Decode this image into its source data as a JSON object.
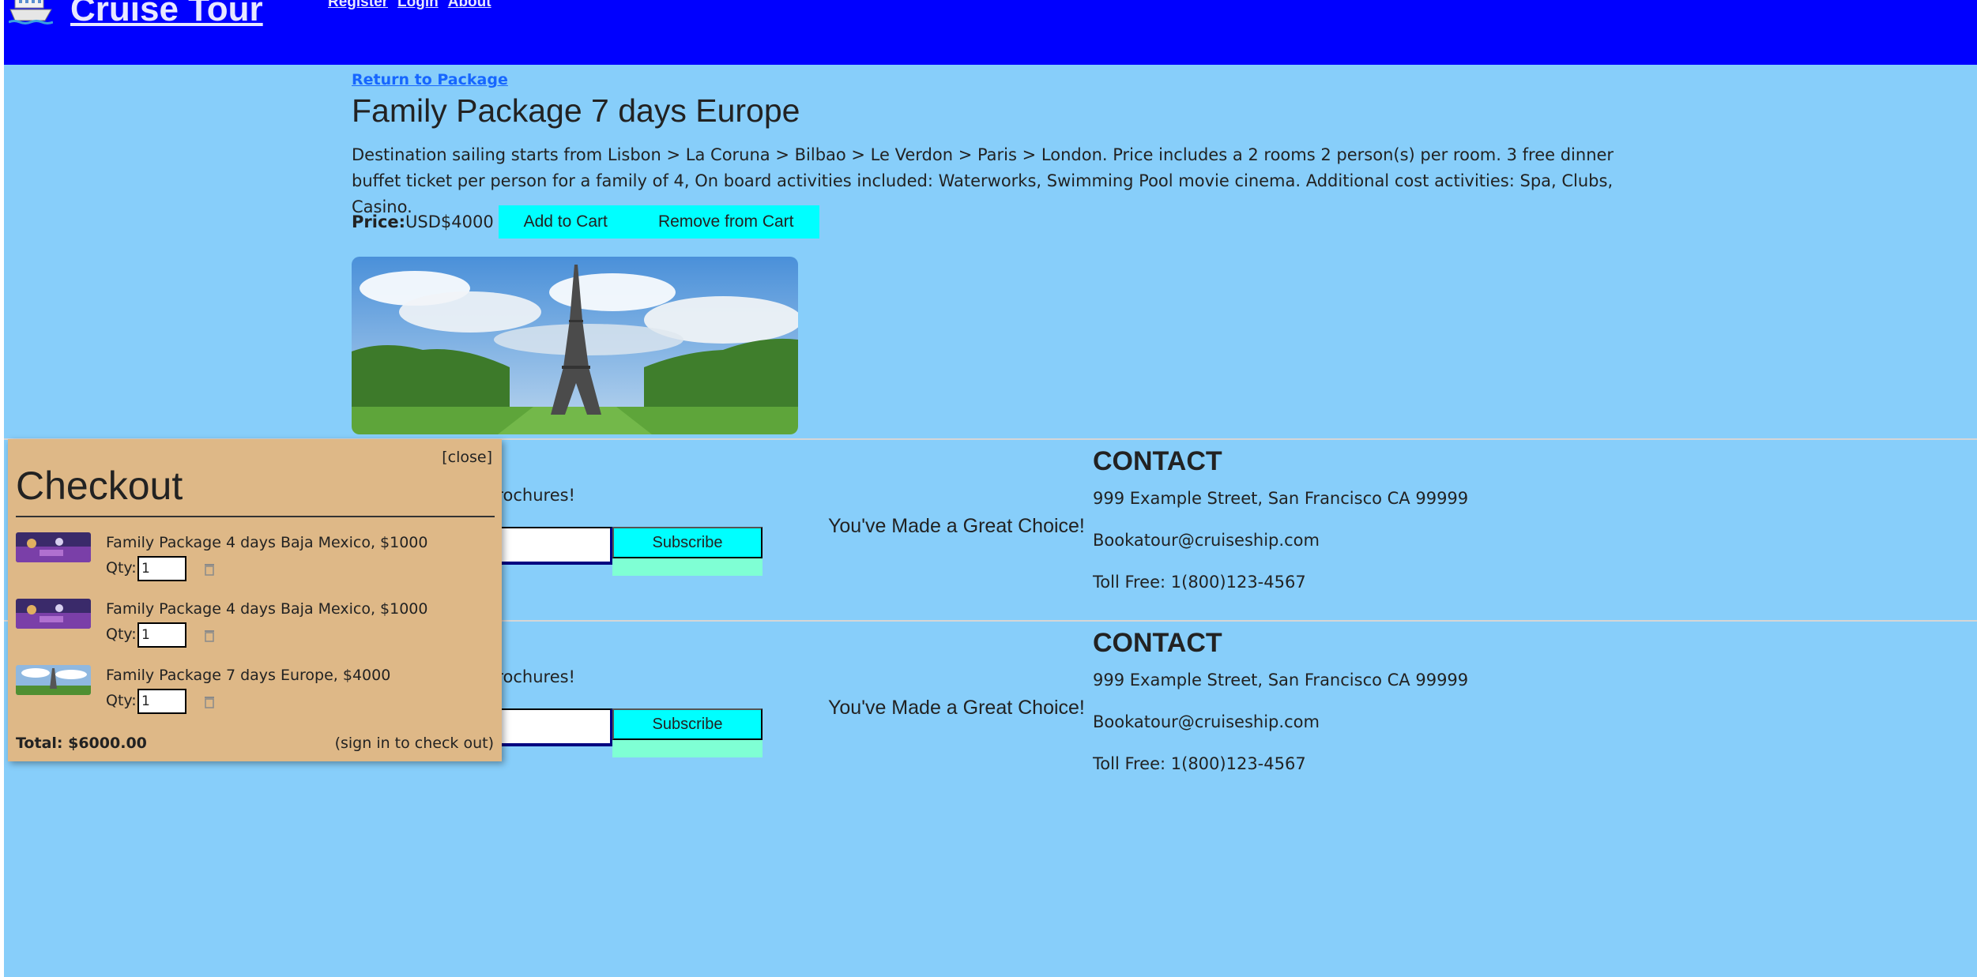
{
  "header": {
    "brand": "Cruise Tour",
    "brand_icon": "ship-icon",
    "nav": [
      "Register",
      "Login",
      "About"
    ]
  },
  "main": {
    "return_link": "Return to Package",
    "title": "Family Package 7 days Europe",
    "description": "Destination sailing starts from Lisbon > La Coruna > Bilbao > Le Verdon > Paris > London. Price includes a 2 rooms 2 person(s) per room. 3 free dinner buffet ticket per person for a family of 4, On board activities included: Waterworks, Swimming Pool movie cinema. Additional cost activities: Spa, Clubs, Casino.",
    "price_label": "Price:",
    "price_value": "USD$4000",
    "add_to_cart": "Add to Cart",
    "remove_from_cart": "Remove from Cart"
  },
  "footer": {
    "promo_text": "prochures!",
    "subscribe": "Subscribe",
    "great_choice": "You've Made a Great Choice!",
    "contact_heading": "CONTACT",
    "address": "999 Example Street, San Francisco CA 99999",
    "email": "Bookatour@cruiseship.com",
    "phone": "Toll Free: 1(800)123-4567"
  },
  "checkout": {
    "close": "[close]",
    "title": "Checkout",
    "qty_label": "Qty:",
    "items": [
      {
        "name": "Family Package 4 days Baja Mexico, $1000",
        "qty": "1"
      },
      {
        "name": "Family Package 4 days Baja Mexico, $1000",
        "qty": "1"
      },
      {
        "name": "Family Package 7 days Europe, $4000",
        "qty": "1"
      }
    ],
    "total": "Total: $6000.00",
    "signin_note": "(sign in to check out)"
  },
  "colors": {
    "page_bg": "#87cefa",
    "header_bg": "#0000ff",
    "button_bg": "#00ffff",
    "checkout_bg": "#deb887",
    "link": "#1666ff"
  }
}
